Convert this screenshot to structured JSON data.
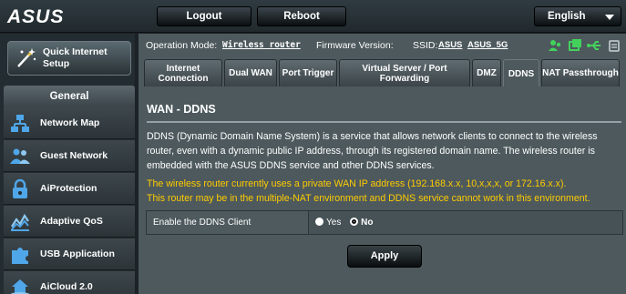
{
  "brand": {
    "logo_text": "ASUS"
  },
  "topbar": {
    "logout_label": "Logout",
    "reboot_label": "Reboot",
    "language_label": "English"
  },
  "sidebar": {
    "quick_setup_label": "Quick Internet Setup",
    "general_header": "General",
    "items": [
      {
        "label": "Network Map",
        "icon": "network-map-icon"
      },
      {
        "label": "Guest Network",
        "icon": "guest-network-icon"
      },
      {
        "label": "AiProtection",
        "icon": "lock-icon"
      },
      {
        "label": "Adaptive QoS",
        "icon": "qos-chart-icon"
      },
      {
        "label": "USB Application",
        "icon": "puzzle-icon"
      },
      {
        "label": "AiCloud 2.0",
        "icon": "cloud-house-icon"
      }
    ]
  },
  "header": {
    "operation_mode_label": "Operation Mode:",
    "operation_mode_value": "Wireless router",
    "firmware_label": "Firmware Version:",
    "ssid_label": "SSID:",
    "ssid_1": "ASUS",
    "ssid_2": "ASUS_5G"
  },
  "tabs": [
    {
      "label": "Internet Connection"
    },
    {
      "label": "Dual WAN"
    },
    {
      "label": "Port Trigger"
    },
    {
      "label": "Virtual Server / Port Forwarding"
    },
    {
      "label": "DMZ"
    },
    {
      "label": "DDNS",
      "active": true
    },
    {
      "label": "NAT Passthrough"
    }
  ],
  "main": {
    "title": "WAN - DDNS",
    "description": "DDNS (Dynamic Domain Name System) is a service that allows network clients to connect to the wireless router, even with a dynamic public IP address, through its registered domain name. The wireless router is embedded with the ASUS DDNS service and other DDNS services.",
    "warning_1": "The wireless router currently uses a private WAN IP address (192.168.x.x, 10,x,x,x, or 172.16.x.x).",
    "warning_2": "This router may be in the multiple-NAT environment and DDNS service cannot work in this environment.",
    "enable_label": "Enable the DDNS Client",
    "option_yes": "Yes",
    "option_no": "No",
    "selected": "No",
    "apply_label": "Apply"
  },
  "colors": {
    "warning": "#ffcc00",
    "background": "#4d595d",
    "sidebar": "#232c31"
  }
}
